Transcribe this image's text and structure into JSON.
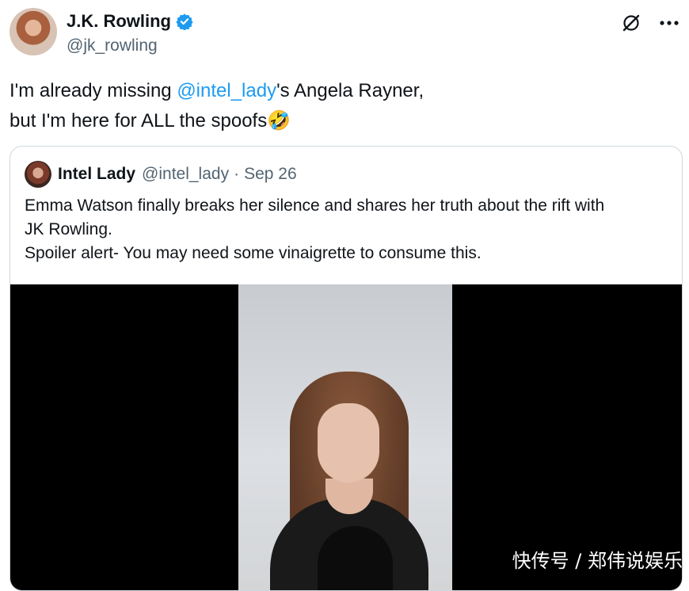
{
  "author": {
    "display_name": "J.K. Rowling",
    "handle": "@jk_rowling",
    "verified_icon": "verified-badge-icon"
  },
  "top_icons": [
    "grok-icon",
    "more-options-icon"
  ],
  "tweet": {
    "text_part1": "I'm already missing ",
    "mention": "@intel_lady",
    "text_part2": "'s Angela Rayner,",
    "line2": "but I'm here for ALL the spoofs",
    "emoji": "🤣"
  },
  "quote": {
    "display_name": "Intel Lady",
    "handle": "@intel_lady",
    "separator": "·",
    "date": "Sep 26",
    "line1": "Emma Watson finally breaks her silence and shares her truth about the rift with",
    "line2": "JK Rowling.",
    "line3": "Spoiler alert- You may need some vinaigrette to consume this."
  },
  "watermark": "快传号 / 郑伟说娱乐",
  "colors": {
    "mention": "#1d9bf0",
    "verified": "#1d9bf0",
    "secondary_text": "#536471"
  }
}
